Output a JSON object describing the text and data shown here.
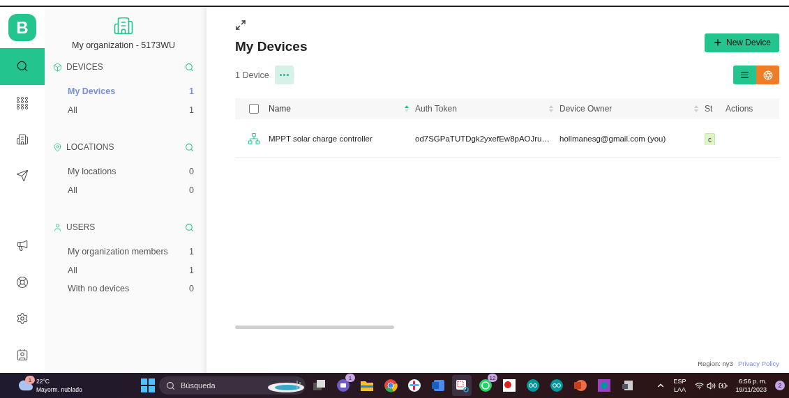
{
  "rail": {
    "logo": "B",
    "items": [
      {
        "kind": "search",
        "selected": true
      },
      {
        "kind": "grid",
        "selected": false
      },
      {
        "kind": "building",
        "selected": false
      },
      {
        "kind": "send",
        "selected": false
      },
      {
        "kind": "megaphone",
        "selected": false
      },
      {
        "kind": "lifebuoy",
        "selected": false
      },
      {
        "kind": "gear",
        "selected": false
      },
      {
        "kind": "user",
        "selected": false
      }
    ]
  },
  "sidebar": {
    "org": "My organization - 5173WU",
    "sections": [
      {
        "kind": "cube",
        "title": "DEVICES",
        "items": [
          {
            "label": "My Devices",
            "count": "1",
            "selected": true
          },
          {
            "label": "All",
            "count": "1",
            "selected": false
          }
        ]
      },
      {
        "kind": "pin",
        "title": "LOCATIONS",
        "items": [
          {
            "label": "My locations",
            "count": "0",
            "selected": false
          },
          {
            "label": "All",
            "count": "0",
            "selected": false
          }
        ]
      },
      {
        "kind": "user",
        "title": "USERS",
        "items": [
          {
            "label": "My organization members",
            "count": "1",
            "selected": false
          },
          {
            "label": "All",
            "count": "1",
            "selected": false
          },
          {
            "label": "With no devices",
            "count": "0",
            "selected": false
          }
        ]
      }
    ]
  },
  "main": {
    "title": "My Devices",
    "new_button": "New Device",
    "count_label": "1 Device",
    "view": {
      "list_selected": true
    },
    "table": {
      "select_all_checked": false,
      "columns": [
        {
          "label": "Name",
          "sortable": true,
          "sorted": true
        },
        {
          "label": "Auth Token",
          "sortable": true,
          "sorted": false
        },
        {
          "label": "Device Owner",
          "sortable": true,
          "sorted": false
        },
        {
          "label": "St"
        },
        {
          "label": "Actions"
        }
      ],
      "rows": [
        {
          "name": "MPPT solar charge controller",
          "token": "od7SGPaTUTDgk2yxefEw8pAOJru…",
          "owner": "hollmanesg@gmail.com (you)",
          "status": "c"
        }
      ]
    }
  },
  "footer": {
    "region": "Region: ny3",
    "privacy": "Privacy Policy"
  },
  "taskbar": {
    "weather": {
      "badge": "1",
      "temp": "22°C",
      "desc": "Mayorm. nublado"
    },
    "search": {
      "placeholder": "Búsqueda"
    },
    "apps": [
      {
        "kind": "taskview",
        "active": false
      },
      {
        "kind": "teams",
        "badge": "1",
        "active": false
      },
      {
        "kind": "files",
        "active": false
      },
      {
        "kind": "chrome",
        "active": false
      },
      {
        "kind": "slack",
        "active": false
      },
      {
        "kind": "word",
        "active": false
      },
      {
        "kind": "snip",
        "active": true
      },
      {
        "kind": "whatsapp",
        "badge": "12",
        "active": false
      },
      {
        "kind": "cs",
        "active": false
      },
      {
        "kind": "arduino",
        "active": false
      },
      {
        "kind": "arduino",
        "active": false
      },
      {
        "kind": "powerpoint",
        "active": false
      },
      {
        "kind": "arduino2",
        "active": false
      },
      {
        "kind": "device",
        "active": false
      }
    ],
    "lang": "ESP",
    "layout": "LAA",
    "time": "6:56 p. m.",
    "date": "19/11/2023",
    "notifications": "2"
  }
}
